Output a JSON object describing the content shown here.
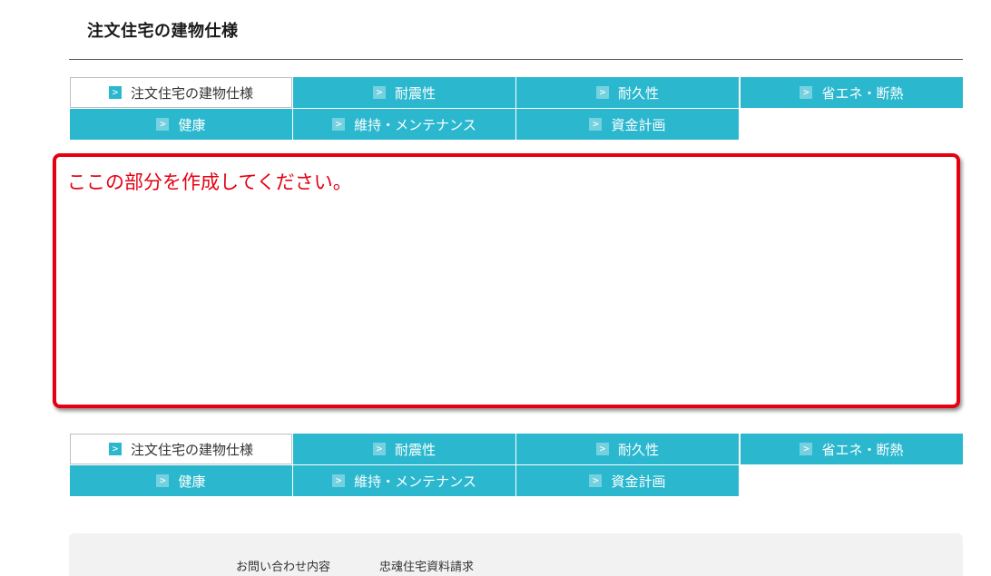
{
  "page": {
    "title": "注文住宅の建物仕様"
  },
  "nav_arrow": ">",
  "nav_top": {
    "tabs": [
      {
        "label": "注文住宅の建物仕様",
        "active": true
      },
      {
        "label": "耐震性"
      },
      {
        "label": "耐久性"
      },
      {
        "label": "省エネ・断熱"
      },
      {
        "label": "健康"
      },
      {
        "label": "維持・メンテナンス"
      },
      {
        "label": "資金計画"
      }
    ]
  },
  "nav_bottom": {
    "tabs": [
      {
        "label": "注文住宅の建物仕様",
        "active": true
      },
      {
        "label": "耐震性"
      },
      {
        "label": "耐久性"
      },
      {
        "label": "省エネ・断熱"
      },
      {
        "label": "健康"
      },
      {
        "label": "維持・メンテナンス"
      },
      {
        "label": "資金計画"
      }
    ]
  },
  "placeholder": {
    "text": "ここの部分を作成してください。"
  },
  "footer": {
    "links": [
      "お問い合わせ内容",
      "忠魂住宅資料請求"
    ]
  },
  "colors": {
    "accent": "#2bb8cf",
    "highlight_border": "#e60012",
    "footer_bg": "#f2f2f2"
  }
}
